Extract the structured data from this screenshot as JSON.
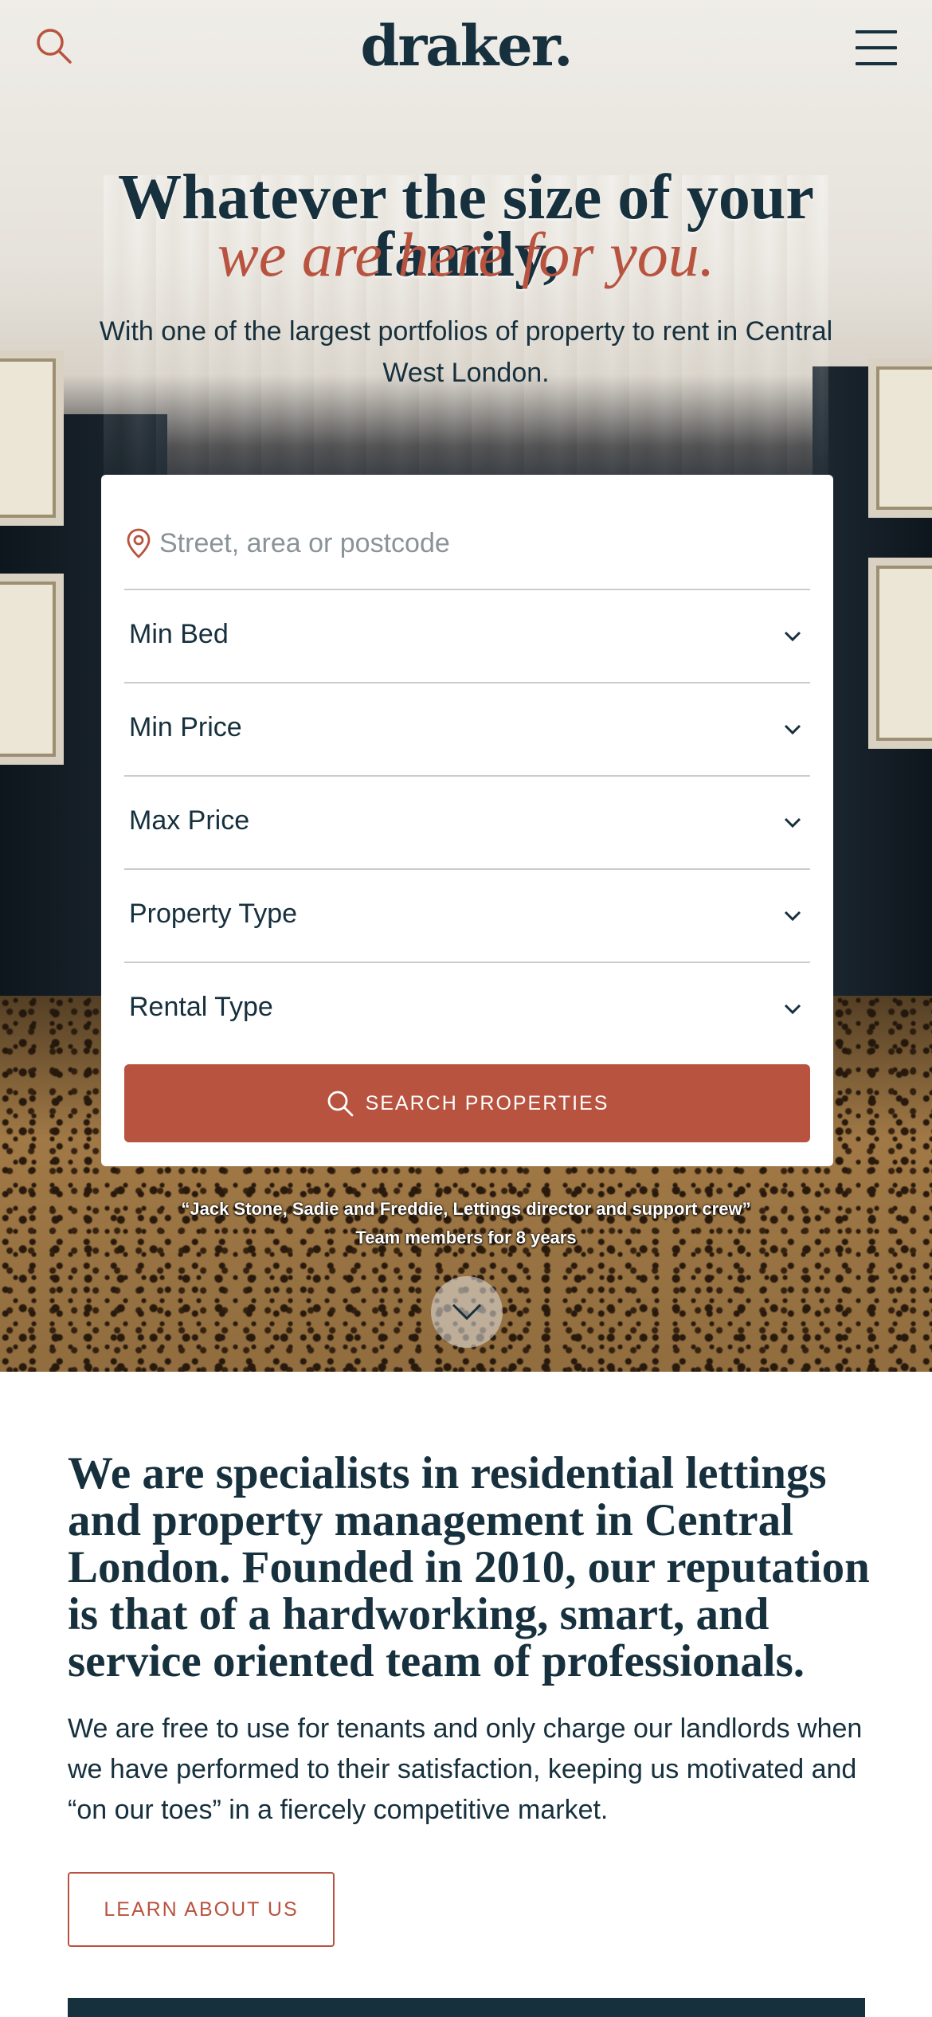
{
  "header": {
    "logo_text": "draker.",
    "search_icon": "search-icon",
    "menu_icon": "hamburger-menu-icon"
  },
  "hero": {
    "title": "Whatever the size of your family,",
    "title_accent": "we are here for you.",
    "subtitle": "With one of the largest portfolios of property to rent in Central West London.",
    "caption_line1": "“Jack Stone, Sadie and Freddie, Lettings director and support crew”",
    "caption_line2": "Team members for 8 years",
    "scroll_icon": "chevron-down-icon"
  },
  "search": {
    "location_placeholder": "Street, area or postcode",
    "location_icon": "map-pin-icon",
    "filters": [
      {
        "label": "Min Bed"
      },
      {
        "label": "Min Price"
      },
      {
        "label": "Max Price"
      },
      {
        "label": "Property Type"
      },
      {
        "label": "Rental Type"
      }
    ],
    "submit_label": "SEARCH PROPERTIES"
  },
  "intro": {
    "heading": "We are specialists in residential lettings and property management in Central London. Founded in 2010, our reputation is that of a hardworking, smart, and service oriented team of professionals.",
    "body": "We are free to use for tenants and only charge our landlords when we have performed to their satisfaction, keeping us motivated and “on our toes” in a fiercely competitive market.",
    "cta_label": "LEARN ABOUT US"
  },
  "colors": {
    "navy": "#16303d",
    "terracotta": "#b8533f",
    "background": "#efede8"
  }
}
